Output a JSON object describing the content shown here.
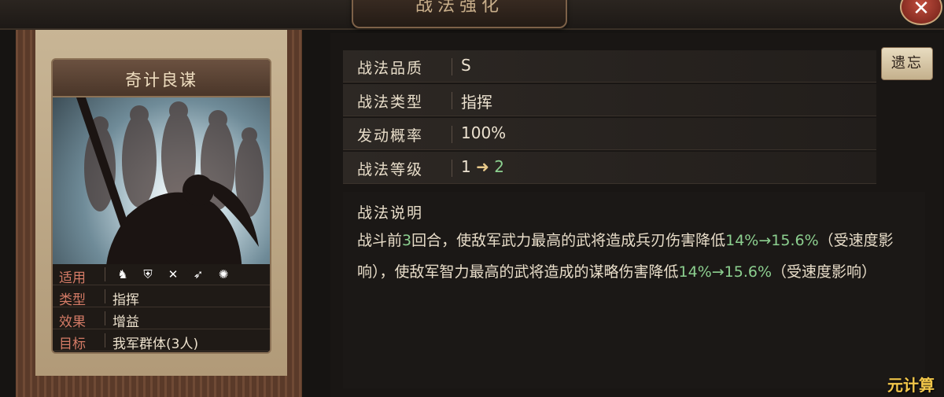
{
  "window": {
    "title": "战法强化",
    "close_label": "✕"
  },
  "card": {
    "name": "奇计良谋",
    "stats": [
      {
        "key": "适用",
        "value": ""
      },
      {
        "key": "类型",
        "value": "指挥"
      },
      {
        "key": "效果",
        "value": "增益"
      },
      {
        "key": "目标",
        "value": "我军群体(3人)"
      }
    ],
    "applicable_icons": [
      "cavalry-icon",
      "shield-icon",
      "bow-icon",
      "spear-icon",
      "wheel-icon"
    ]
  },
  "properties": [
    {
      "key": "战法品质",
      "value": "S"
    },
    {
      "key": "战法类型",
      "value": "指挥"
    },
    {
      "key": "发动概率",
      "value": "100%"
    },
    {
      "key": "战法等级",
      "from": "1",
      "arrow": "➜",
      "to": "2"
    }
  ],
  "reset_button": "遗忘",
  "description": {
    "title": "战法说明",
    "parts": [
      {
        "text": "战斗前",
        "green": false
      },
      {
        "text": "3",
        "green": true
      },
      {
        "text": "回合，使敌军武力最高的武将造成兵刃伤害降低",
        "green": false
      },
      {
        "text": "14%→15.6%",
        "green": true
      },
      {
        "text": "（受速度影响），使敌军智力最高的武将造成的谋略伤害降低",
        "green": false
      },
      {
        "text": "14%→15.6%",
        "green": true
      },
      {
        "text": "（受速度影响）",
        "green": false
      }
    ]
  },
  "watermark": "元计算"
}
